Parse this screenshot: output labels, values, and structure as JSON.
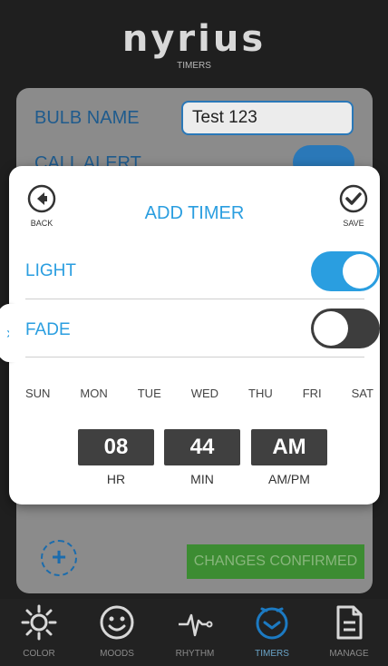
{
  "header": {
    "logo": "nyrius",
    "section": "TIMERS"
  },
  "background": {
    "bulb_name_label": "BULB NAME",
    "bulb_name_value": "Test 123",
    "call_alert_label": "CALL ALERT",
    "changes_confirmed": "CHANGES CONFIRMED"
  },
  "modal": {
    "title": "ADD TIMER",
    "back_label": "BACK",
    "save_label": "SAVE",
    "light_label": "LIGHT",
    "light_on": true,
    "fade_label": "FADE",
    "fade_on": false,
    "days": [
      "SUN",
      "MON",
      "TUE",
      "WED",
      "THU",
      "FRI",
      "SAT"
    ],
    "time": {
      "hour": "08",
      "minute": "44",
      "ampm": "AM"
    },
    "time_labels": {
      "hour": "HR",
      "minute": "MIN",
      "ampm": "AM/PM"
    }
  },
  "nav": {
    "items": [
      {
        "label": "COLOR",
        "icon": "sun-icon"
      },
      {
        "label": "MOODS",
        "icon": "smiley-icon"
      },
      {
        "label": "RHYTHM",
        "icon": "pulse-icon"
      },
      {
        "label": "TIMERS",
        "icon": "clock-icon",
        "active": true
      },
      {
        "label": "MANAGE",
        "icon": "document-icon"
      }
    ]
  },
  "colors": {
    "accent": "#2a9ee0",
    "dark": "#404040",
    "confirm": "#3c8c32"
  }
}
